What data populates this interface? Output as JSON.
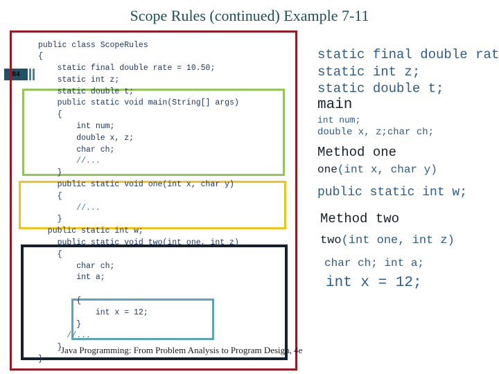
{
  "slide": {
    "title": "Scope Rules (continued) Example 7-11",
    "number": "84",
    "footer": "Java Programming: From Problem Analysis to Program Design, 4e"
  },
  "colors": {
    "title": "#1F4E5A",
    "class_box": "#A01722",
    "main_box": "#92C55A",
    "one_box": "#F0C419",
    "two_box": "#17202E",
    "inner_box": "#5BA3B8",
    "code_text": "#1F3864",
    "comment": "#3C7D9E",
    "badge_bg": "#1F5266"
  },
  "code": {
    "lines": [
      "public class ScopeRules",
      "{",
      "    static final double rate = 10.50;",
      "    static int z;",
      "    static double t;",
      "    public static void main(String[] args)",
      "    {",
      "        int num;",
      "        double x, z;",
      "        char ch;",
      "        //...",
      "    }",
      "    public static void one(int x, char y)",
      "    {",
      "        //...",
      "    }",
      "  public static int w;",
      "    public static void two(int one, int z)",
      "    {",
      "        char ch;",
      "        int a;",
      "",
      "        {",
      "            int x = 12;",
      "        }",
      "      //...",
      "    }",
      "}"
    ]
  },
  "annotations": {
    "rate": "static final double rate",
    "z": "static int z;",
    "t": "static double t;",
    "main": "main",
    "num": "int num;",
    "xzch": "double x, z;char ch;",
    "method_one_label": "Method one",
    "one_signature_name": "one",
    "one_signature_params": "(int x, char y)",
    "w": "public static int w;",
    "method_two_label": "Method two",
    "two_signature_name": "two",
    "two_signature_params": "(int one, int z)",
    "ch_int_a": "char ch; int a;",
    "int_x": "int x = 12;"
  }
}
